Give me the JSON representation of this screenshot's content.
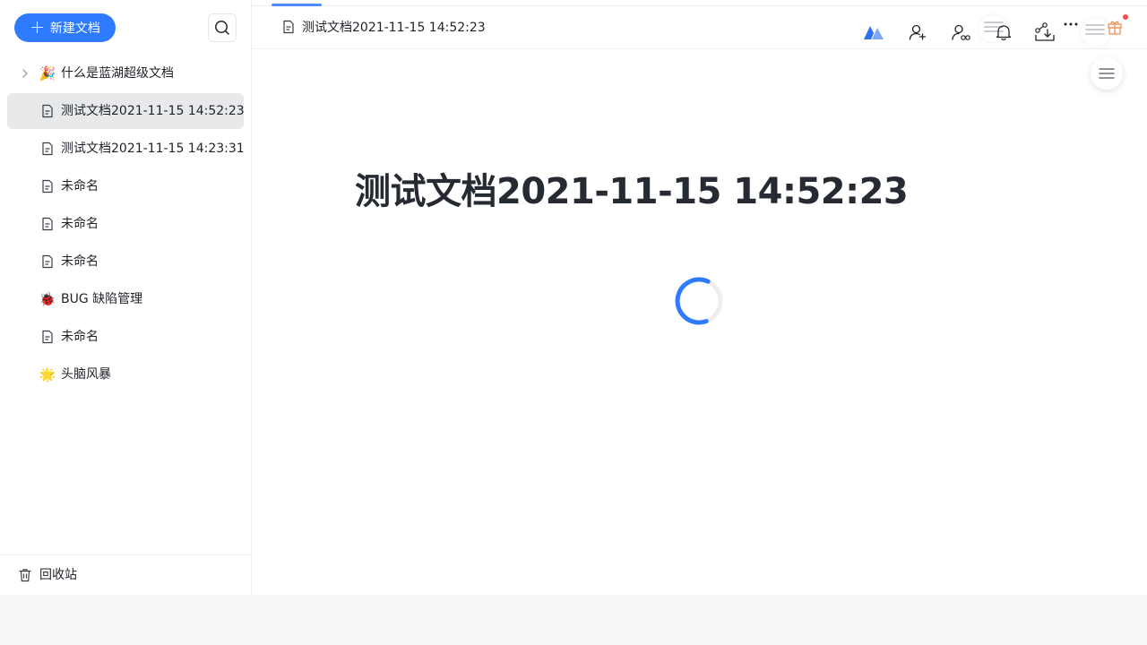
{
  "sidebar": {
    "new_doc_label": "新建文档",
    "search_icon": "search-icon",
    "items": [
      {
        "label": "什么是蓝湖超级文档",
        "icon": "party-popper-emoji",
        "glyph": "🎉",
        "expandable": true,
        "active": false
      },
      {
        "label": "测试文档2021-11-15 14:52:23",
        "icon": "document-icon",
        "active": true
      },
      {
        "label": "测试文档2021-11-15 14:23:31",
        "icon": "document-icon",
        "active": false
      },
      {
        "label": "未命名",
        "icon": "document-icon",
        "active": false
      },
      {
        "label": "未命名",
        "icon": "document-icon",
        "active": false
      },
      {
        "label": "未命名",
        "icon": "document-icon",
        "active": false
      },
      {
        "label": "BUG 缺陷管理",
        "icon": "ladybug-emoji",
        "glyph": "🐞",
        "active": false
      },
      {
        "label": "未命名",
        "icon": "document-icon",
        "active": false
      },
      {
        "label": "头脑风暴",
        "icon": "sparkle-emoji",
        "glyph": "🌟",
        "active": false
      }
    ],
    "trash_label": "回收站"
  },
  "topbar": {
    "tab_label": "测试文档2021-11-15 14:52:23",
    "icons": [
      "lanhu-logo-icon",
      "add-member-icon",
      "collaborators-icon",
      "bell-icon",
      "share-export-icon",
      "more-icon",
      "gift-icon"
    ]
  },
  "document": {
    "title": "测试文档2021-11-15 14:52:23",
    "loading": true
  },
  "colors": {
    "accent": "#2f7bff",
    "active_item_bg": "#e8e9eb",
    "notification_dot": "#f54a45"
  }
}
